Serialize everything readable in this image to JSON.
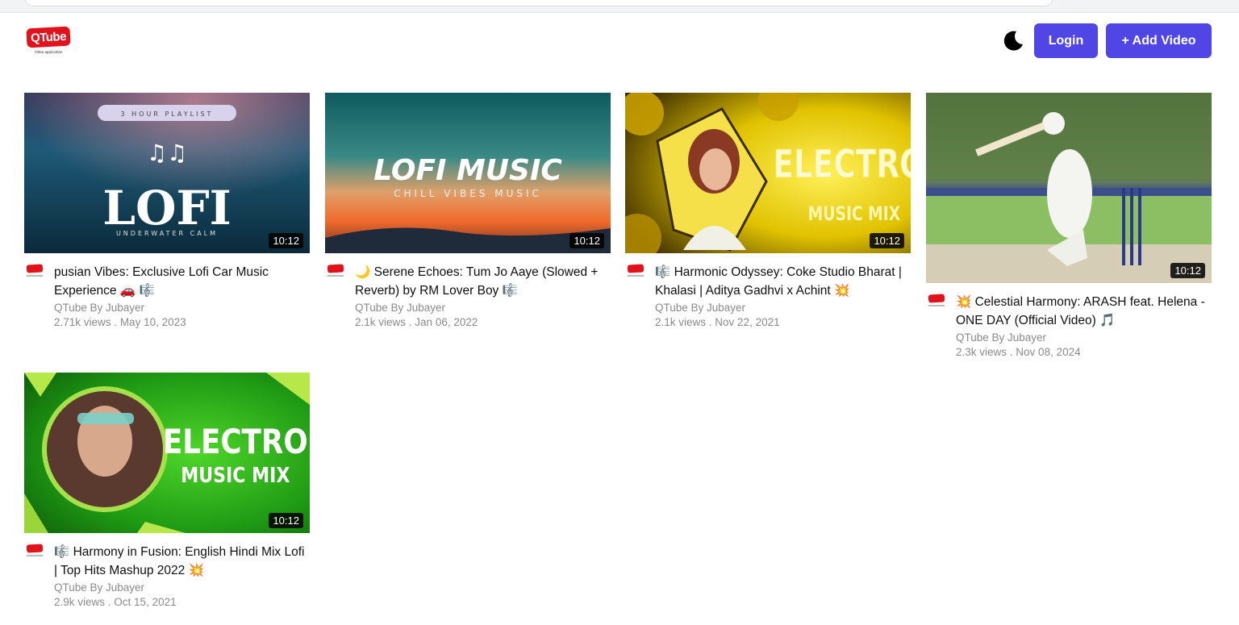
{
  "header": {
    "logo_text": "QTube",
    "logo_tagline": "Video application",
    "login_label": "Login",
    "add_video_label": "+ Add Video"
  },
  "videos": [
    {
      "thumb_title": "LOFI",
      "thumb_top": "3 HOUR PLAYLIST",
      "thumb_sub": "UNDERWATER CALM",
      "duration": "10:12",
      "title": "pusian Vibes: Exclusive Lofi Car Music Experience 🚗 🎼",
      "channel": "QTube By Jubayer",
      "views": "2.71k views",
      "date": "May 10, 2023"
    },
    {
      "thumb_title": "LOFI MUSIC",
      "thumb_sub": "CHILL VIBES MUSIC",
      "duration": "10:12",
      "title": "🌙 Serene Echoes: Tum Jo Aaye (Slowed + Reverb) by RM Lover Boy 🎼",
      "channel": "QTube By Jubayer",
      "views": "2.1k views",
      "date": "Jan 06, 2022"
    },
    {
      "thumb_title": "ELECTRO",
      "thumb_sub": "MUSIC MIX",
      "duration": "10:12",
      "title": "🎼 Harmonic Odyssey: Coke Studio Bharat | Khalasi | Aditya Gadhvi x Achint 💥",
      "channel": "QTube By Jubayer",
      "views": "2.1k views",
      "date": "Nov 22, 2021"
    },
    {
      "duration": "10:12",
      "title": "💥 Celestial Harmony: ARASH feat. Helena - ONE DAY (Official Video) 🎵",
      "channel": "QTube By Jubayer",
      "views": "2.3k views",
      "date": "Nov 08, 2024"
    },
    {
      "thumb_title": "ELECTRO",
      "thumb_sub": "MUSIC MIX",
      "duration": "10:12",
      "title": "🎼 Harmony in Fusion: English Hindi Mix Lofi | Top Hits Mashup 2022 💥",
      "channel": "QTube By Jubayer",
      "views": "2.9k views",
      "date": "Oct 15, 2021"
    }
  ],
  "stats_separator": " . "
}
